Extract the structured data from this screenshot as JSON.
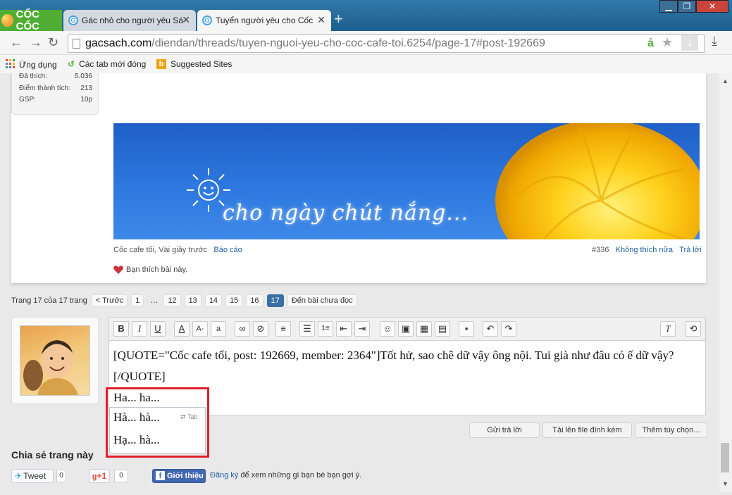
{
  "browser": {
    "brand": "CỐC CỐC",
    "tabs": [
      {
        "title": "Gác nhỏ cho người yêu Sá",
        "favicon": "G"
      },
      {
        "title": "Tuyển người yêu cho Cốc",
        "favicon": "G"
      }
    ],
    "window_buttons": {
      "minimize": "▁",
      "restore": "❐",
      "close": "✕"
    },
    "url_domain": "gacsach.com",
    "url_path": "/diendan/threads/tuyen-nguoi-yeu-cho-coc-cafe-toi.6254/page-17#post-192669",
    "bookmarks": [
      "Ứng dụng",
      "Các tab mới đóng",
      "Suggested Sites"
    ]
  },
  "user_stats": [
    {
      "label": "Đã thích:",
      "value": "5.036"
    },
    {
      "label": "Điểm thành tích:",
      "value": "213"
    },
    {
      "label": "GSP:",
      "value": "10p"
    }
  ],
  "banner": {
    "text": "cho ngày chút nắng..."
  },
  "post_meta": {
    "author_time": "Cốc cafe tối, Vài giây trước",
    "report": "Báo cáo",
    "number": "#336",
    "unlike": "Không thích nữa",
    "reply": "Trả lời",
    "liked_text": "Bạn thích bài này."
  },
  "pagination": {
    "summary": "Trang 17 của 17 trang",
    "prev": "< Trước",
    "pages": [
      "1",
      "…",
      "12",
      "13",
      "14",
      "15",
      "16",
      "17"
    ],
    "current": "17",
    "unread": "Đến bài chưa đọc"
  },
  "editor": {
    "content": "[QUOTE=\"Cốc cafe tối, post: 192669, member: 2364\"]Tốt hử, sao chê dữ vậy ông nội. Tui già như đâu có ế dữ vậy?[/QUOTE]",
    "typed": "Ha... ha...",
    "suggestions": [
      "Hà... hà...",
      "Hạ... hà..."
    ],
    "suggestion_hint": "Tab"
  },
  "actions": {
    "submit": "Gửi trả lời",
    "upload": "Tải lên file đính kèm",
    "more": "Thêm tùy chọn..."
  },
  "share": {
    "title": "Chia sẻ trang này",
    "tweet": "Tweet",
    "tweet_count": "0",
    "gplus": "+1",
    "gplus_count": "0",
    "fb_button": "Giới thiệu",
    "fb_signup": "Đăng ký",
    "fb_text": "để xem những gì bạn bè bạn gợi ý."
  }
}
